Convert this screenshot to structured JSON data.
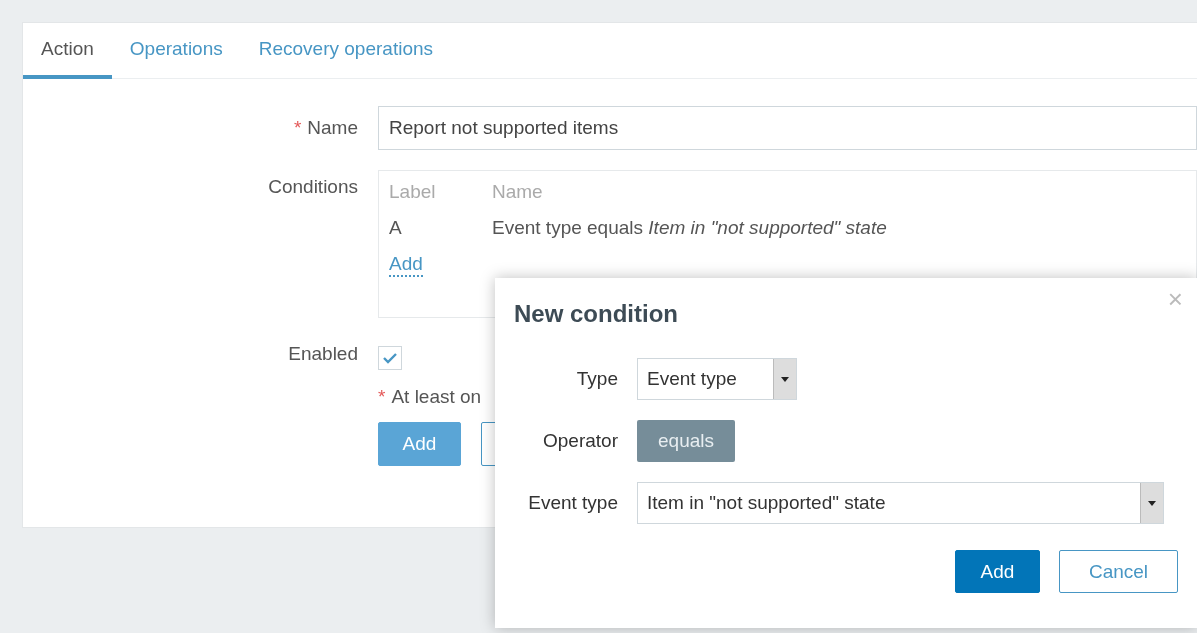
{
  "tabs": [
    {
      "label": "Action",
      "selected": true
    },
    {
      "label": "Operations",
      "selected": false
    },
    {
      "label": "Recovery operations",
      "selected": false
    }
  ],
  "form": {
    "name": {
      "label": "Name",
      "required_mark": "*",
      "value": "Report not supported items"
    },
    "conditions": {
      "label": "Conditions",
      "columns": [
        "Label",
        "Name"
      ],
      "rows": [
        {
          "label": "A",
          "name": "Event type equals *Item in \"not supported\" state*"
        }
      ],
      "add_link": "Add"
    },
    "enabled": {
      "label": "Enabled",
      "checked": true
    },
    "note": {
      "required_mark": "*",
      "text": "At least on"
    },
    "buttons": [
      {
        "kind": "primary",
        "label": "Add"
      },
      {
        "kind": "secondary"
      }
    ]
  },
  "dialog": {
    "title": "New condition",
    "close": "×",
    "fields": [
      {
        "label": "Type",
        "kind": "dropdown",
        "value": "Event type"
      },
      {
        "label": "Operator",
        "kind": "badge",
        "value": "equals"
      },
      {
        "label": "Event type",
        "kind": "wide_dropdown",
        "value": "Item in \"not supported\" state"
      }
    ],
    "buttons": [
      {
        "kind": "primary",
        "label": "Add"
      },
      {
        "kind": "secondary",
        "label": "Cancel"
      }
    ]
  }
}
